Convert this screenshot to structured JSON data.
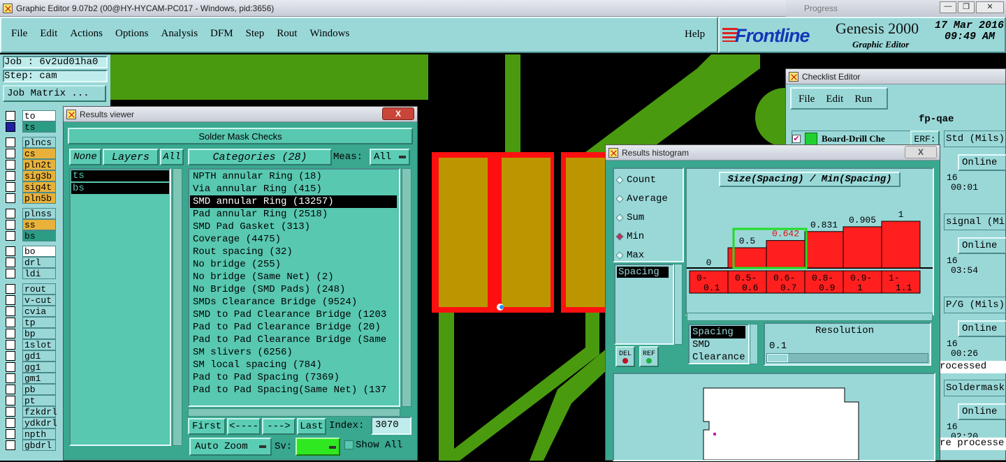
{
  "window": {
    "title": "Graphic Editor 9.07b2 (00@HY-HYCAM-PC017 - Windows, pid:3656)",
    "bg_title": "Progress"
  },
  "menu": [
    "File",
    "Edit",
    "Actions",
    "Options",
    "Analysis",
    "DFM",
    "Step",
    "Rout",
    "Windows"
  ],
  "help": "Help",
  "brand": {
    "logo": "Frontline",
    "product": "Genesis 2000",
    "sub": "Graphic Editor",
    "date": "17 Mar 2016",
    "time": "09:49 AM"
  },
  "job": {
    "job": "Job : 6v2ud01ha0",
    "step": "Step: cam",
    "matrix": "Job Matrix ..."
  },
  "layers": [
    {
      "n": "to",
      "c": "#ffffff"
    },
    {
      "n": "ts",
      "c": "#2c9c84"
    },
    {
      "n": "plncs",
      "c": "#9ad8d8"
    },
    {
      "n": "cs",
      "c": "#e8b23a"
    },
    {
      "n": "pln2t",
      "c": "#e8b23a"
    },
    {
      "n": "sig3b",
      "c": "#e8b23a"
    },
    {
      "n": "sig4t",
      "c": "#e8b23a"
    },
    {
      "n": "pln5b",
      "c": "#e8b23a"
    },
    {
      "n": "plnss",
      "c": "#9ad8d8"
    },
    {
      "n": "ss",
      "c": "#e8b23a"
    },
    {
      "n": "bs",
      "c": "#2c9c84"
    },
    {
      "n": "bo",
      "c": "#ffffff"
    },
    {
      "n": "drl",
      "c": "#9ad8d8"
    },
    {
      "n": "ldi",
      "c": "#9ad8d8"
    },
    {
      "n": "rout",
      "c": "#9ad8d8"
    },
    {
      "n": "v-cut",
      "c": "#9ad8d8"
    },
    {
      "n": "cvia",
      "c": "#9ad8d8"
    },
    {
      "n": "tp",
      "c": "#9ad8d8"
    },
    {
      "n": "bp",
      "c": "#9ad8d8"
    },
    {
      "n": "1slot",
      "c": "#9ad8d8"
    },
    {
      "n": "gd1",
      "c": "#9ad8d8"
    },
    {
      "n": "gg1",
      "c": "#9ad8d8"
    },
    {
      "n": "gm1",
      "c": "#9ad8d8"
    },
    {
      "n": "pb",
      "c": "#9ad8d8"
    },
    {
      "n": "pt",
      "c": "#9ad8d8"
    },
    {
      "n": "fzkdrl",
      "c": "#9ad8d8"
    },
    {
      "n": "ydkdrl",
      "c": "#9ad8d8"
    },
    {
      "n": "npth",
      "c": "#9ad8d8"
    },
    {
      "n": "gbdrl",
      "c": "#9ad8d8"
    }
  ],
  "results": {
    "title": "Results viewer",
    "close": "X",
    "header": "Solder Mask Checks",
    "none": "None",
    "layers_btn": "Layers",
    "all": "All",
    "layer_items": [
      "ts",
      "bs"
    ],
    "categories_btn": "Categories (28)",
    "meas_label": "Meas:",
    "meas_value": "All",
    "categories": [
      "NPTH annular Ring (18)",
      "Via annular Ring (415)",
      "SMD annular Ring (13257)",
      "Pad annular Ring (2518)",
      "SMD Pad Gasket (313)",
      "Coverage (4475)",
      "Rout spacing (32)",
      "No bridge (255)",
      "No bridge (Same Net) (2)",
      "No Bridge (SMD Pads) (248)",
      "SMDs Clearance Bridge (9524)",
      "SMD to Pad Clearance Bridge (1203",
      "Pad to Pad Clearance Bridge (20)",
      "Pad to Pad Clearance Bridge (Same",
      "SM slivers (6256)",
      "SM local spacing (784)",
      "Pad to Pad Spacing (7369)",
      "Pad to Pad Spacing(Same Net) (137"
    ],
    "selected": 2,
    "first": "First",
    "prev": "<----",
    "next": "--->",
    "last": "Last",
    "index_label": "Index:",
    "index_value": "3070",
    "autozoom": "Auto Zoom",
    "sv": "Sv:",
    "showall": "Show All"
  },
  "histogram": {
    "title": "Results histogram",
    "close": "X",
    "options": [
      "Count",
      "Average",
      "Sum",
      "Min",
      "Max"
    ],
    "selected_option": 3,
    "list_item": "Spacing",
    "chart_title": "Size(Spacing) / Min(Spacing)",
    "del": "DEL",
    "ref": "REF",
    "measure_list": [
      "Spacing",
      "SMD",
      "Clearance"
    ],
    "resolution_label": "Resolution",
    "resolution_value": "0.1"
  },
  "chart_data": {
    "type": "bar",
    "title": "Size(Spacing) / Min(Spacing)",
    "categories": [
      "0-0.1",
      "0.5-0.6",
      "0.6-0.7",
      "0.8-0.9",
      "0.9-1",
      "1-1.1"
    ],
    "values": [
      0,
      0.5,
      0.642,
      0.831,
      0.905,
      1
    ],
    "value_labels": [
      "0",
      "0.5",
      "0.642",
      "0.831",
      "0.905",
      "1"
    ],
    "category_labels": [
      [
        "0-",
        "0.1"
      ],
      [
        "0.5-",
        "0.6"
      ],
      [
        "0.6-",
        "0.7"
      ],
      [
        "0.8-",
        "0.9"
      ],
      [
        "0.9-",
        "1"
      ],
      [
        "1-",
        "1.1"
      ]
    ],
    "highlighted": [
      1,
      2
    ],
    "bar_color": "#ff1f1f",
    "ylim": [
      0,
      1
    ]
  },
  "checklist": {
    "title": "Checklist Editor",
    "menu": [
      "File",
      "Edit",
      "Run"
    ],
    "name": "fp-qae",
    "item": "Board-Drill Che",
    "erf": "ERF:",
    "rows": [
      "Std (Mils)",
      "signal (Mi",
      "P/G (Mils)",
      "Soldermask"
    ],
    "online": "Online",
    "sixteen": "16",
    "times": [
      "00:01",
      "03:54",
      "00:26",
      "02:20"
    ],
    "processed": [
      "rocessed",
      "re processe"
    ]
  }
}
